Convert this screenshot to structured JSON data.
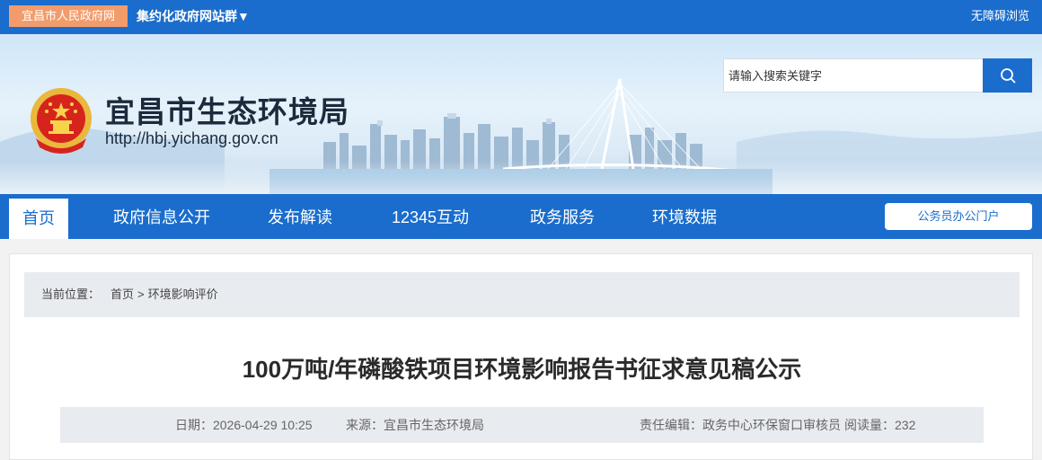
{
  "topbar": {
    "home_link": "宜昌市人民政府网",
    "site_group": "集约化政府网站群▼",
    "accessibility": "无障碍浏览"
  },
  "header": {
    "org_name": "宜昌市生态环境局",
    "url": "http://hbj.yichang.gov.cn",
    "search_placeholder": "请输入搜索关键字"
  },
  "nav": {
    "tabs": [
      "首页",
      "政府信息公开",
      "发布解读",
      "12345互动",
      "政务服务",
      "环境数据"
    ],
    "active_index": 0,
    "portal_button": "公务员办公门户"
  },
  "breadcrumb": {
    "label": "当前位置：",
    "home": "首页",
    "separator": ">",
    "current": "环境影响评价"
  },
  "article": {
    "title": "100万吨/年磷酸铁项目环境影响报告书征求意见稿公示",
    "date": "日期：2026-04-29 10:25",
    "source": "来源：宜昌市生态环境局",
    "editor": "责任编辑：政务中心环保窗口审核员",
    "views": "阅读量：232"
  },
  "colors": {
    "primary": "#1a6dcc",
    "home_link_bg": "#f29c6b",
    "breadcrumb_bg": "#e8ebef"
  }
}
